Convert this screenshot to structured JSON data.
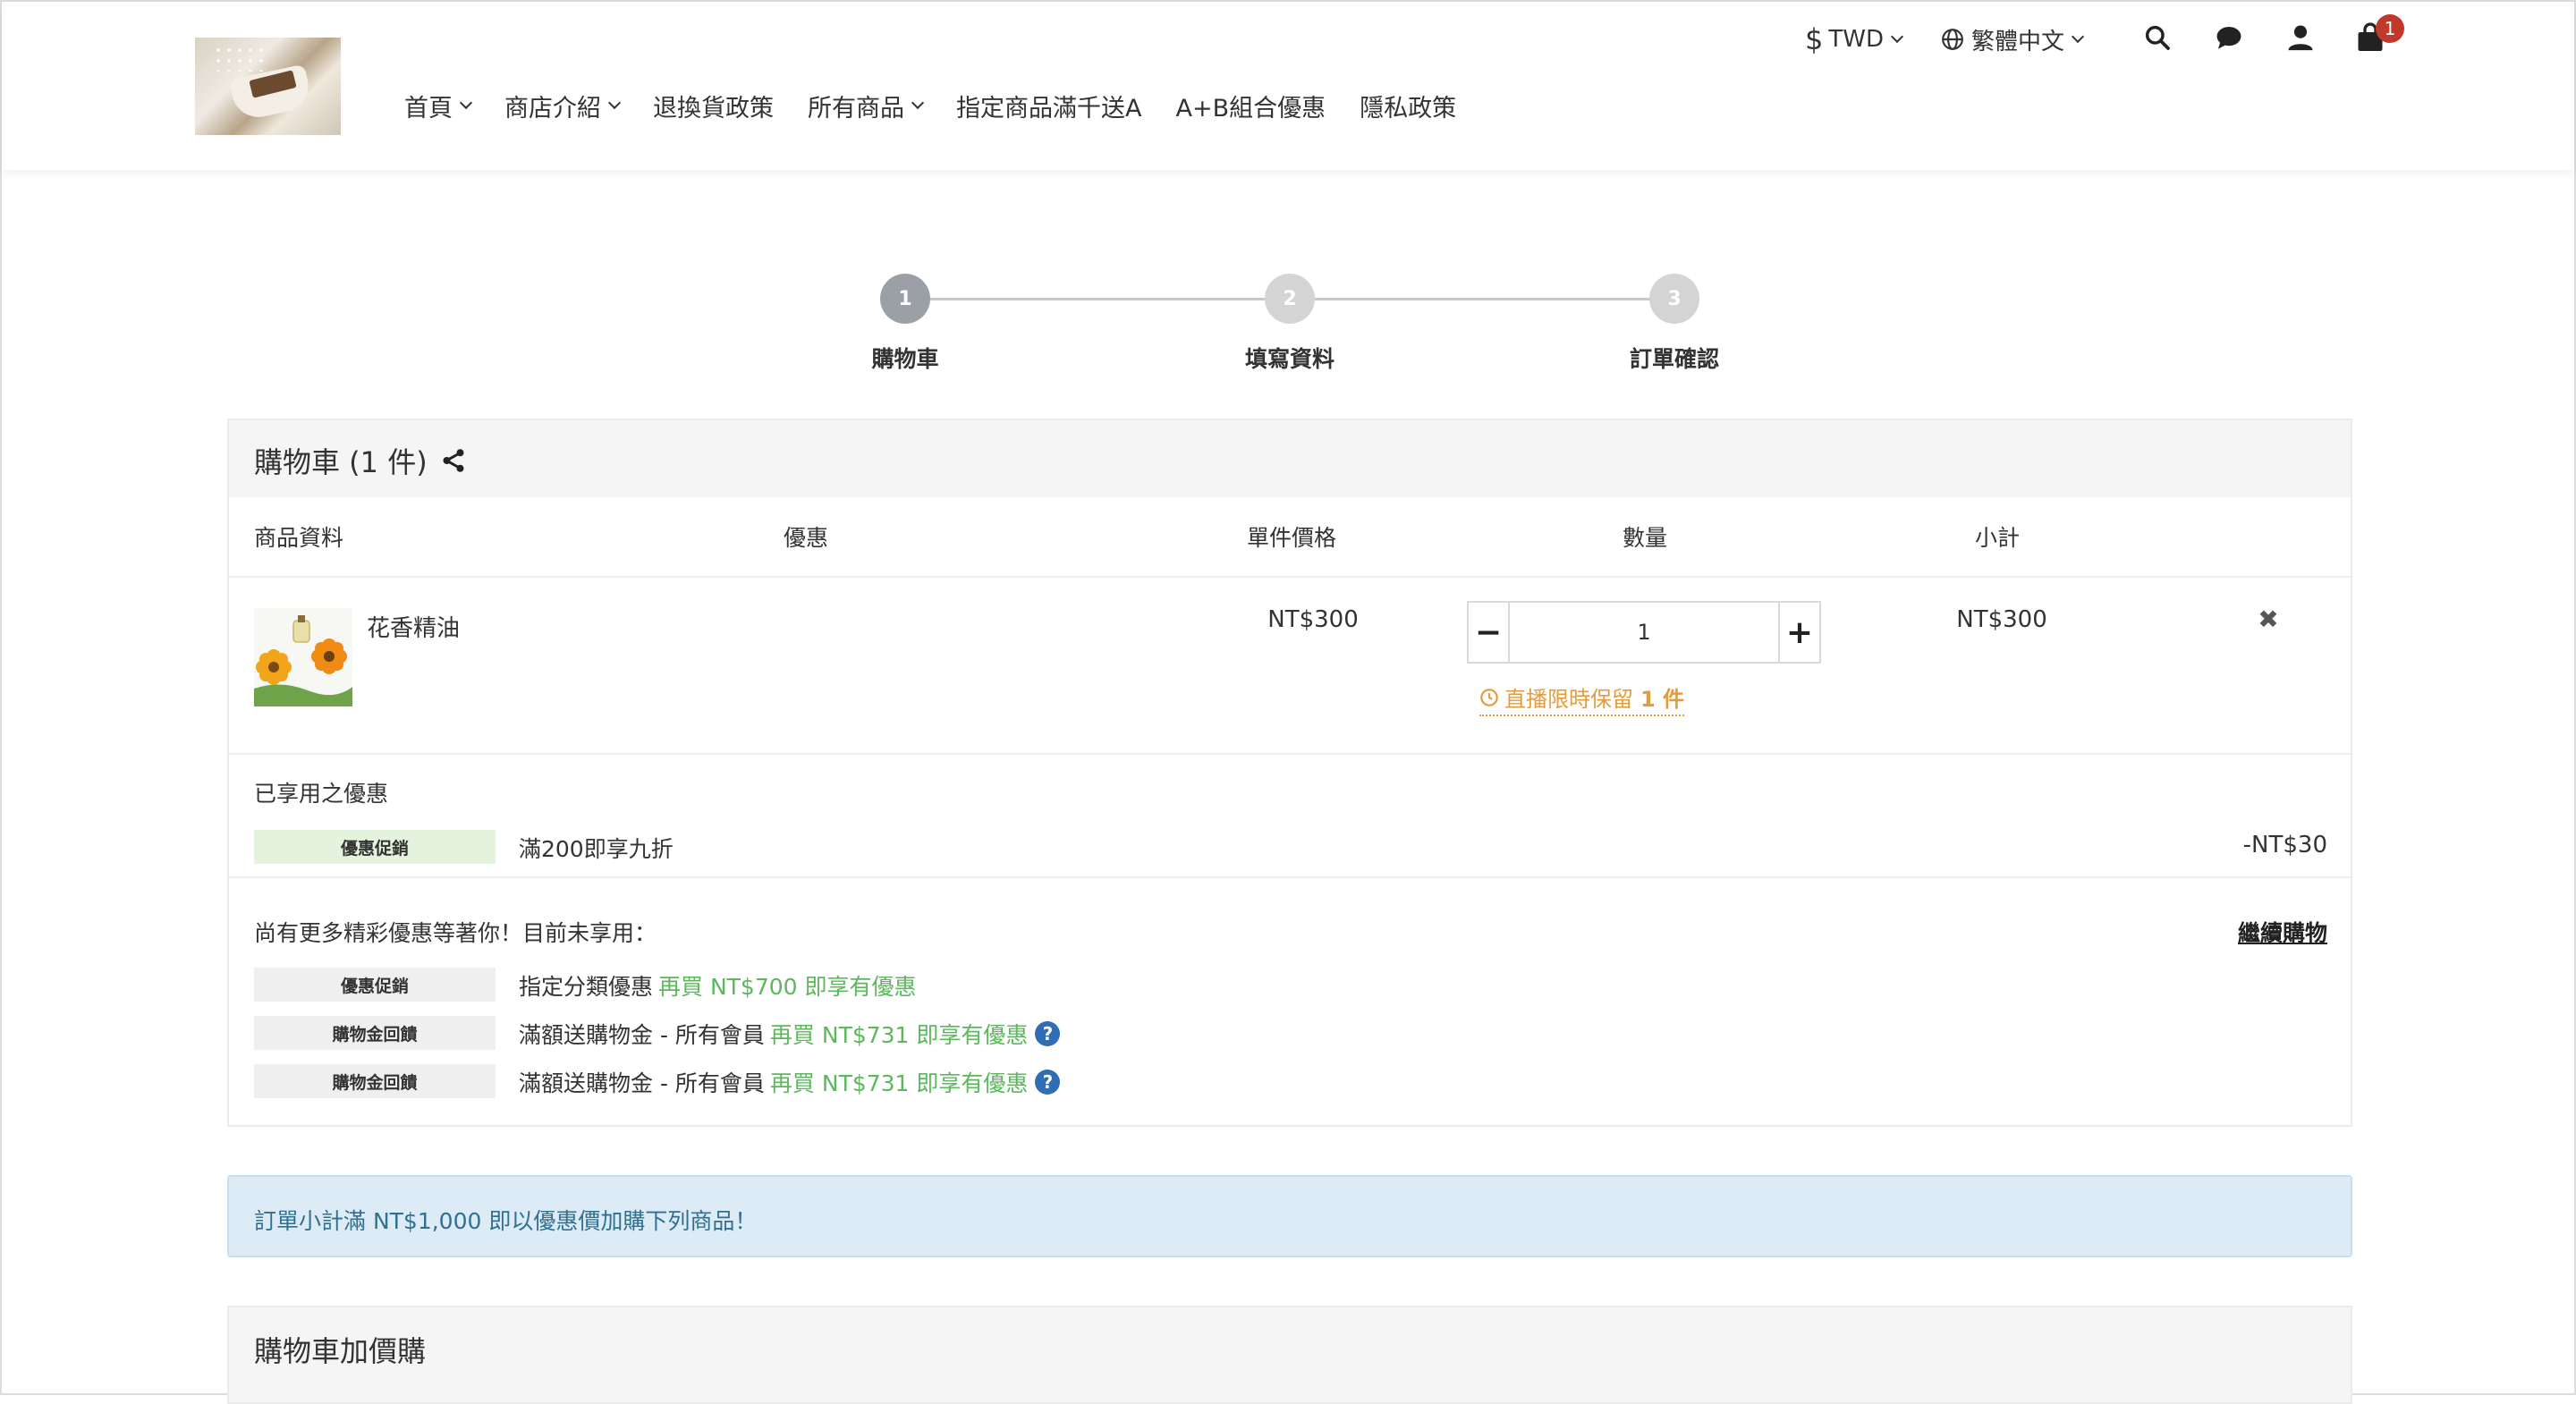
{
  "header": {
    "nav": [
      {
        "label": "首頁",
        "dropdown": true
      },
      {
        "label": "商店介紹",
        "dropdown": true
      },
      {
        "label": "退換貨政策",
        "dropdown": false
      },
      {
        "label": "所有商品",
        "dropdown": true
      },
      {
        "label": "指定商品滿千送A",
        "dropdown": false
      },
      {
        "label": "A+B組合優惠",
        "dropdown": false
      },
      {
        "label": "隱私政策",
        "dropdown": false
      }
    ],
    "currency": "TWD",
    "currency_symbol": "$",
    "language": "繁體中文",
    "cart_count": "1",
    "icons": [
      "search-icon",
      "chat-icon",
      "user-icon",
      "cart-icon"
    ]
  },
  "steps": [
    {
      "num": "1",
      "label": "購物車"
    },
    {
      "num": "2",
      "label": "填寫資料"
    },
    {
      "num": "3",
      "label": "訂單確認"
    }
  ],
  "cart": {
    "title": "購物車 (1 件)",
    "columns": {
      "product": "商品資料",
      "promo": "優惠",
      "unit_price": "單件價格",
      "quantity": "數量",
      "subtotal": "小計"
    },
    "items": [
      {
        "name": "花香精油",
        "unit_price": "NT$300",
        "quantity": "1",
        "subtotal": "NT$300",
        "reserve_text": "直播限時保留",
        "reserve_count": "1 件"
      }
    ],
    "applied_title": "已享用之優惠",
    "applied": [
      {
        "tag": "優惠促銷",
        "text": "滿200即享九折",
        "amount": "-NT$30"
      }
    ],
    "more_title": "尚有更多精彩優惠等著你！目前未享用：",
    "continue_label": "繼續購物",
    "unapplied": [
      {
        "tag": "優惠促銷",
        "text": "指定分類優惠",
        "hint": "再買 NT$700 即享有優惠",
        "help": false
      },
      {
        "tag": "購物金回饋",
        "text": "滿額送購物金 - 所有會員",
        "hint": "再買 NT$731 即享有優惠",
        "help": true
      },
      {
        "tag": "購物金回饋",
        "text": "滿額送購物金 - 所有會員",
        "hint": "再買 NT$731 即享有優惠",
        "help": true
      }
    ]
  },
  "alert": "訂單小計滿 NT$1,000 即以優惠價加購下列商品！",
  "addon_title": "購物車加價購",
  "colors": {
    "accent_orange": "#e69b3a",
    "promo_green": "#5cb85c",
    "alert_bg": "#dcebf6",
    "alert_text": "#31708f",
    "badge_red": "#c0392b"
  }
}
